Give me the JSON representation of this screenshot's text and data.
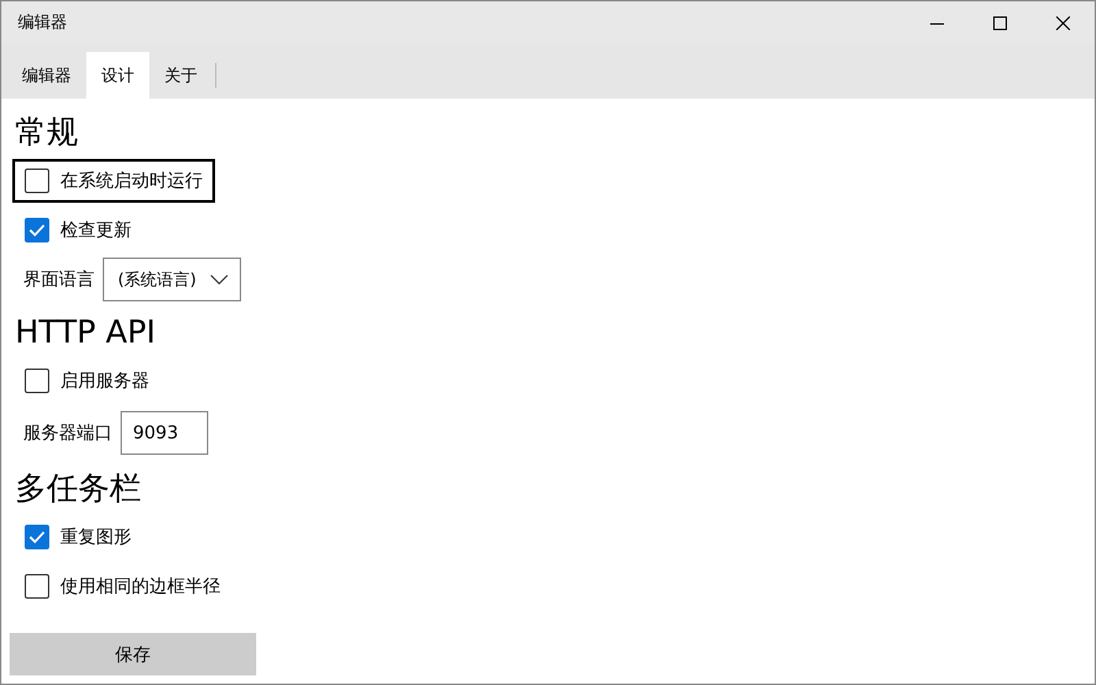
{
  "window": {
    "title": "编辑器"
  },
  "tabs": [
    {
      "label": "编辑器",
      "selected": false
    },
    {
      "label": "设计",
      "selected": true
    },
    {
      "label": "关于",
      "selected": false
    }
  ],
  "sections": [
    {
      "title": "常规",
      "items": [
        {
          "kind": "checkbox",
          "label": "在系统启动时运行",
          "checked": false,
          "focused": true
        },
        {
          "kind": "checkbox",
          "label": "检查更新",
          "checked": true,
          "focused": false
        },
        {
          "kind": "dropdown",
          "label": "界面语言",
          "value": "(系统语言)"
        }
      ]
    },
    {
      "title": "HTTP API",
      "items": [
        {
          "kind": "checkbox",
          "label": "启用服务器",
          "checked": false,
          "focused": false
        },
        {
          "kind": "textfield",
          "label": "服务器端口",
          "value": "9093"
        }
      ]
    },
    {
      "title": "多任务栏",
      "items": [
        {
          "kind": "checkbox",
          "label": "重复图形",
          "checked": true,
          "focused": false
        },
        {
          "kind": "checkbox",
          "label": "使用相同的边框半径",
          "checked": false,
          "focused": false
        }
      ]
    }
  ],
  "save_button": "保存"
}
